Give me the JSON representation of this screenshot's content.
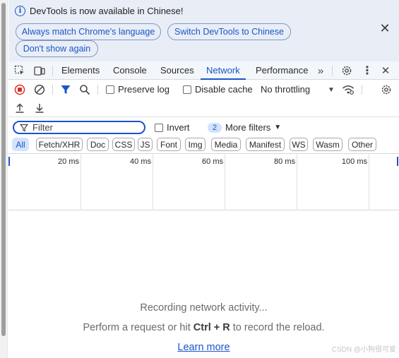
{
  "infobar": {
    "message": "DevTools is now available in Chinese!",
    "btn_match": "Always match Chrome's language",
    "btn_switch": "Switch DevTools to Chinese",
    "btn_dont_show": "Don't show again"
  },
  "tabs": {
    "elements": "Elements",
    "console": "Console",
    "sources": "Sources",
    "network": "Network",
    "performance": "Performance"
  },
  "toolbar": {
    "preserve_log": "Preserve log",
    "disable_cache": "Disable cache",
    "throttling": "No throttling"
  },
  "filter": {
    "placeholder": "Filter",
    "invert": "Invert",
    "more_filters_count": "2",
    "more_filters": "More filters"
  },
  "types": [
    "All",
    "Fetch/XHR",
    "Doc",
    "CSS",
    "JS",
    "Font",
    "Img",
    "Media",
    "Manifest",
    "WS",
    "Wasm",
    "Other"
  ],
  "timeline": {
    "t20": "20 ms",
    "t40": "40 ms",
    "t60": "60 ms",
    "t80": "80 ms",
    "t100": "100 ms"
  },
  "empty": {
    "recording": "Recording network activity...",
    "perform_pre": "Perform a request or hit ",
    "shortcut": "Ctrl + R",
    "perform_post": " to record the reload.",
    "learn_more": "Learn more"
  },
  "watermark": "CSDN @小狗很可爱",
  "colors": {
    "accent": "#1a55c9",
    "record": "#d93025",
    "infobar_bg": "#e9eef6"
  }
}
